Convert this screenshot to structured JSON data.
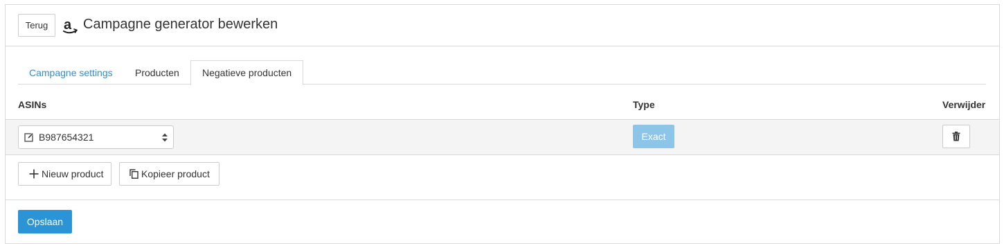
{
  "header": {
    "back_label": "Terug",
    "title": "Campagne generator bewerken",
    "brand_icon": "amazon-icon"
  },
  "tabs": [
    {
      "label": "Campagne settings",
      "state": "link"
    },
    {
      "label": "Producten",
      "state": "default"
    },
    {
      "label": "Negatieve producten",
      "state": "active"
    }
  ],
  "table": {
    "columns": [
      "ASINs",
      "Type",
      "Verwijder"
    ],
    "rows": [
      {
        "asin": "B987654321",
        "type": "Exact"
      }
    ]
  },
  "actions": {
    "new_product_label": "Nieuw product",
    "copy_product_label": "Kopieer product"
  },
  "footer": {
    "save_label": "Opslaan"
  },
  "colors": {
    "link": "#2d8fd0",
    "primary": "#2a94d6",
    "exact_badge": "#8dc5e8",
    "border": "#d9d9d9",
    "row_band": "#f4f4f4"
  }
}
